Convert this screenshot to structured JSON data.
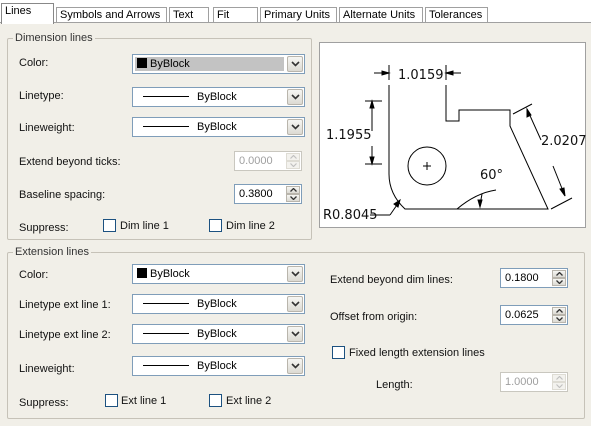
{
  "tabs": [
    {
      "label": "Lines",
      "active": true
    },
    {
      "label": "Symbols and Arrows",
      "active": false
    },
    {
      "label": "Text",
      "active": false
    },
    {
      "label": "Fit",
      "active": false
    },
    {
      "label": "Primary Units",
      "active": false
    },
    {
      "label": "Alternate Units",
      "active": false
    },
    {
      "label": "Tolerances",
      "active": false
    }
  ],
  "dimension_lines": {
    "title": "Dimension lines",
    "color_label": "Color:",
    "color_value": "ByBlock",
    "linetype_label": "Linetype:",
    "linetype_value": "ByBlock",
    "lineweight_label": "Lineweight:",
    "lineweight_value": "ByBlock",
    "extend_label": "Extend beyond ticks:",
    "extend_value": "0.0000",
    "baseline_label": "Baseline spacing:",
    "baseline_value": "0.3800",
    "suppress_label": "Suppress:",
    "dim_line_1": "Dim line 1",
    "dim_line_2": "Dim line 2"
  },
  "extension_lines": {
    "title": "Extension lines",
    "color_label": "Color:",
    "color_value": "ByBlock",
    "linetype1_label": "Linetype ext line 1:",
    "linetype1_value": "ByBlock",
    "linetype2_label": "Linetype ext line 2:",
    "linetype2_value": "ByBlock",
    "lineweight_label": "Lineweight:",
    "lineweight_value": "ByBlock",
    "suppress_label": "Suppress:",
    "ext_line_1": "Ext line 1",
    "ext_line_2": "Ext line 2",
    "extend_beyond_label": "Extend beyond dim lines:",
    "extend_beyond_value": "0.1800",
    "offset_label": "Offset from origin:",
    "offset_value": "0.0625",
    "fixed_length_label": "Fixed length extension lines",
    "length_label": "Length:",
    "length_value": "1.0000"
  },
  "preview": {
    "dim_top": "1.0159",
    "dim_left": "1.1955",
    "dim_right": "2.0207",
    "angle": "60°",
    "radius": "R0.8045"
  },
  "colors": {
    "panel_bg": "#f1efe8",
    "field_border": "#7f9db9",
    "checkbox_border": "#1c5180",
    "disabled_text": "#9a9a9a"
  }
}
